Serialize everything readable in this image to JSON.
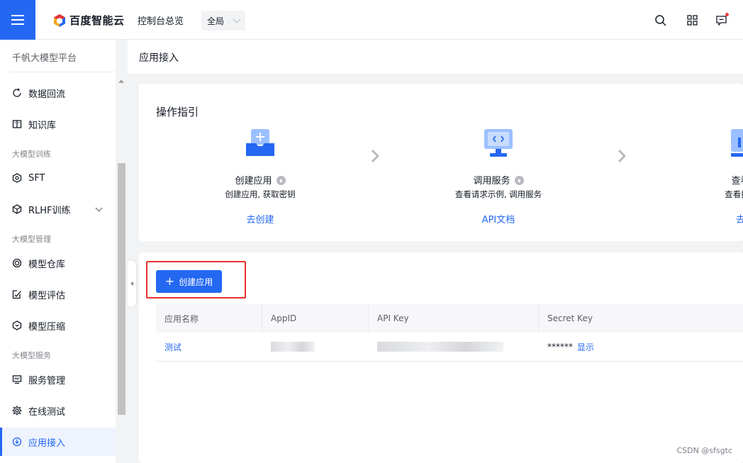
{
  "topbar": {
    "brand": "百度智能云",
    "console": "控制台总览",
    "region": "全局",
    "icons": [
      "search-icon",
      "apps-grid-icon",
      "message-icon"
    ]
  },
  "sidebar": {
    "platform_title": "千帆大模型平台",
    "items": [
      {
        "label": "数据回流",
        "icon": "refresh-icon"
      },
      {
        "label": "知识库",
        "icon": "book-icon"
      },
      {
        "group": "大模型训练"
      },
      {
        "label": "SFT",
        "icon": "cube-icon"
      },
      {
        "label": "RLHF训练",
        "icon": "box-icon",
        "expandable": true
      },
      {
        "group": "大模型管理"
      },
      {
        "label": "模型仓库",
        "icon": "warehouse-icon"
      },
      {
        "label": "模型评估",
        "icon": "evaluate-icon"
      },
      {
        "label": "模型压缩",
        "icon": "compress-icon"
      },
      {
        "group": "大模型服务"
      },
      {
        "label": "服务管理",
        "icon": "monitor-icon"
      },
      {
        "label": "在线测试",
        "icon": "test-icon"
      },
      {
        "label": "应用接入",
        "icon": "download-icon",
        "active": true
      }
    ]
  },
  "page": {
    "title": "应用接入"
  },
  "guide": {
    "title": "操作指引",
    "steps": [
      {
        "name": "创建应用",
        "desc": "创建应用, 获取密钥",
        "link": "去创建"
      },
      {
        "name": "调用服务",
        "desc": "查看请求示例, 调用服务",
        "link": "API文档"
      },
      {
        "name": "查看用",
        "desc": "查看报表了",
        "link": "去查"
      }
    ]
  },
  "list": {
    "create_button": "创建应用",
    "columns": [
      "应用名称",
      "AppID",
      "API Key",
      "Secret Key"
    ],
    "rows": [
      {
        "name": "测试",
        "secret_mask": "******",
        "secret_action": "显示"
      }
    ]
  },
  "watermark": "CSDN @sfsgtc",
  "colors": {
    "accent": "#2468f2",
    "highlight_border": "#e8312f",
    "sidebar_active_bg": "#eef3fe"
  }
}
